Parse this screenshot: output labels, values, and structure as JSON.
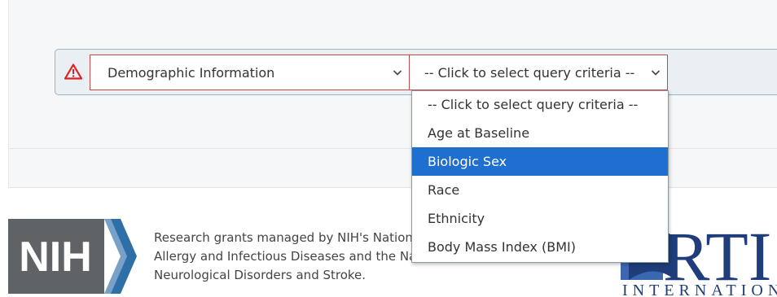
{
  "query_builder": {
    "category_select": {
      "value": "Demographic Information"
    },
    "criteria_select": {
      "value": "-- Click to select query criteria --"
    },
    "dropdown": {
      "options": [
        "-- Click to select query criteria --",
        "Age at Baseline",
        "Biologic Sex",
        "Race",
        "Ethnicity",
        "Body Mass Index (BMI)"
      ],
      "highlighted": "Biologic Sex"
    }
  },
  "footer": {
    "line1": "Research grants managed by NIH's National Institute of",
    "line2": "Allergy and Infectious Diseases and the National Institute of",
    "line3": "Neurological Disorders and Stroke.",
    "nih_logo_text": "NIH",
    "rti_logo_text": "RTI",
    "rti_logo_subtext": "INTERNATIONAL"
  },
  "colors": {
    "warning_red": "#e02020",
    "select_border": "#c64a4a",
    "highlight_blue": "#1f6fd1",
    "nih_gray": "#5f6366",
    "nih_blue": "#2f6fa8",
    "rti_navy": "#1f3d7a"
  }
}
